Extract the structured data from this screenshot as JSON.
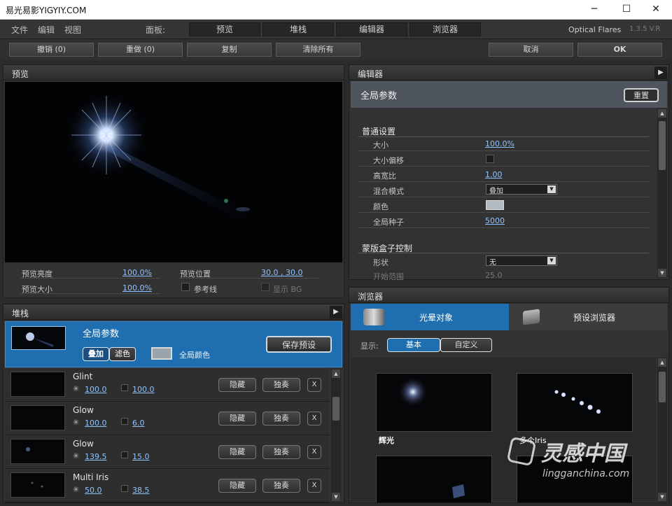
{
  "window": {
    "title": "易光易影YIGYIY.COM",
    "minimize": "─",
    "maximize": "☐",
    "close": "✕"
  },
  "menu": {
    "file": "文件",
    "edit": "编辑",
    "view": "视图",
    "panel_label": "面板:",
    "panel_tabs": [
      "预览",
      "堆栈",
      "编辑器",
      "浏览器"
    ],
    "app_name": "Optical Flares",
    "version": "1.3.5 V.R"
  },
  "toolbar": {
    "undo": "撤销 (0)",
    "redo": "重做 (0)",
    "copy": "复制",
    "clear_all": "清除所有",
    "cancel": "取消",
    "ok": "OK"
  },
  "preview": {
    "title": "预览",
    "brightness_label": "预览亮度",
    "brightness_value": "100.0%",
    "size_label": "预览大小",
    "size_value": "100.0%",
    "position_label": "预览位置",
    "position_value": "30.0 , 30.0",
    "guides_label": "参考线",
    "show_bg_label": "显示 BG"
  },
  "stack": {
    "title": "堆栈",
    "global_title": "全局参数",
    "blend_add": "叠加",
    "blend_screen": "滤色",
    "global_color_label": "全局颜色",
    "save_preset": "保存预设",
    "hide": "隐藏",
    "solo": "独奏",
    "remove": "X",
    "items": [
      {
        "name": "Glint",
        "brightness": "100.0",
        "scale": "100.0"
      },
      {
        "name": "Glow",
        "brightness": "100.0",
        "scale": "6.0"
      },
      {
        "name": "Glow",
        "brightness": "139.5",
        "scale": "15.0"
      },
      {
        "name": "Multi Iris",
        "brightness": "50.0",
        "scale": "38.5"
      }
    ]
  },
  "editor": {
    "title": "编辑器",
    "section_title": "全局参数",
    "reset": "重置",
    "group1": "普通设置",
    "rows": [
      {
        "label": "大小",
        "value": "100.0%"
      },
      {
        "label": "大小偏移",
        "value": ""
      },
      {
        "label": "高宽比",
        "value": "1.00"
      },
      {
        "label": "混合模式",
        "value": "叠加"
      },
      {
        "label": "颜色",
        "value": ""
      },
      {
        "label": "全局种子",
        "value": "5000"
      }
    ],
    "group2": "蒙版盒子控制",
    "shape_label": "形状",
    "shape_value": "无",
    "range_label": "开始范围",
    "range_value": "25.0"
  },
  "browser": {
    "title": "浏览器",
    "tab_lens": "光晕对象",
    "tab_presets": "预设浏览器",
    "show_label": "显示:",
    "filter_basic": "基本",
    "filter_custom": "自定义",
    "items": [
      {
        "name": "辉光"
      },
      {
        "name": "多个Iris"
      }
    ]
  },
  "watermark": {
    "brand": "灵感中国",
    "site": "lingganchina.com"
  }
}
